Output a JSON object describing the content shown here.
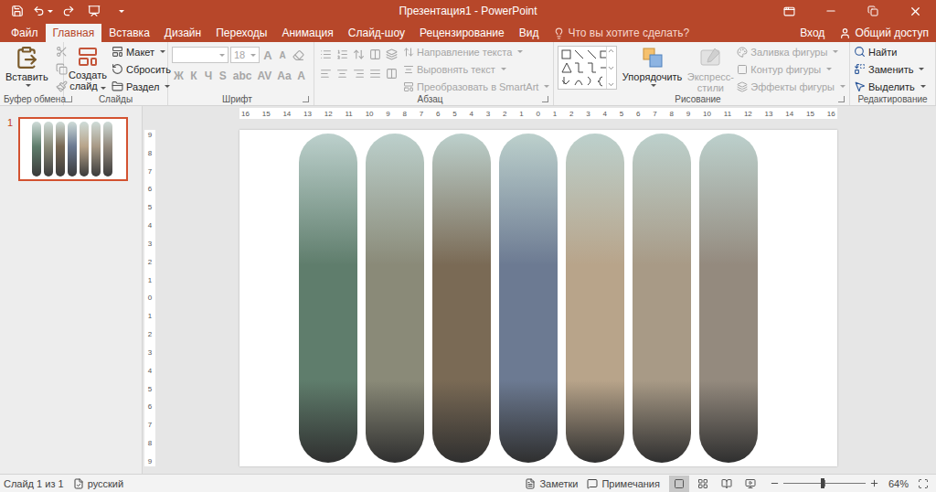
{
  "window": {
    "title": "Презентация1 - PowerPoint"
  },
  "tabs": [
    {
      "label": "Файл",
      "selected": false
    },
    {
      "label": "Главная",
      "selected": true
    },
    {
      "label": "Вставка",
      "selected": false
    },
    {
      "label": "Дизайн",
      "selected": false
    },
    {
      "label": "Переходы",
      "selected": false
    },
    {
      "label": "Анимация",
      "selected": false
    },
    {
      "label": "Слайд-шоу",
      "selected": false
    },
    {
      "label": "Рецензирование",
      "selected": false
    },
    {
      "label": "Вид",
      "selected": false
    }
  ],
  "search": {
    "placeholder": "Что вы хотите сделать?"
  },
  "account": {
    "sign_in": "Вход",
    "share": "Общий доступ"
  },
  "ribbon": {
    "clipboard": {
      "label": "Буфер обмена",
      "paste": "Вставить"
    },
    "slides": {
      "label": "Слайды",
      "new_slide": "Создать слайд",
      "items": [
        {
          "label": "Макет",
          "dropdown": true
        },
        {
          "label": "Сбросить",
          "dropdown": false
        },
        {
          "label": "Раздел",
          "dropdown": true
        }
      ]
    },
    "font": {
      "label": "Шрифт",
      "name": "",
      "size": "18",
      "disabled": true,
      "size_buttons": [
        "A",
        "A"
      ],
      "style_buttons": [
        "Ж",
        "К",
        "Ч",
        "S",
        "abc",
        "AV",
        "Aa",
        "A"
      ]
    },
    "paragraph": {
      "label": "Абзац",
      "disabled": true,
      "commands": [
        "Направление текста",
        "Выровнять текст",
        "Преобразовать в SmartArt"
      ]
    },
    "drawing": {
      "label": "Рисование",
      "arrange": "Упорядочить",
      "quick_styles": "Экспресс-стили",
      "quick_styles_disabled": true,
      "commands": [
        {
          "label": "Заливка фигуры",
          "disabled": true
        },
        {
          "label": "Контур фигуры",
          "disabled": true
        },
        {
          "label": "Эффекты фигуры",
          "disabled": true
        }
      ]
    },
    "editing": {
      "label": "Редактирование",
      "commands": [
        {
          "label": "Найти",
          "dropdown": false
        },
        {
          "label": "Заменить",
          "dropdown": true
        },
        {
          "label": "Выделить",
          "dropdown": true
        }
      ]
    }
  },
  "rulers": {
    "horizontal": [
      "16",
      "15",
      "14",
      "13",
      "12",
      "11",
      "10",
      "9",
      "8",
      "7",
      "6",
      "5",
      "4",
      "3",
      "2",
      "1",
      "0",
      "1",
      "2",
      "3",
      "4",
      "5",
      "6",
      "7",
      "8",
      "9",
      "10",
      "11",
      "12",
      "13",
      "14",
      "15",
      "16"
    ],
    "vertical": [
      "9",
      "8",
      "7",
      "6",
      "5",
      "4",
      "3",
      "2",
      "1",
      "0",
      "1",
      "2",
      "3",
      "4",
      "5",
      "6",
      "7",
      "8",
      "9"
    ]
  },
  "thumbnails": [
    {
      "number": "1",
      "selected": true
    }
  ],
  "slide": {
    "strips": [
      {
        "color": "#5f7d6c"
      },
      {
        "color": "#8a8a78"
      },
      {
        "color": "#7a6a55"
      },
      {
        "color": "#6c7a92"
      },
      {
        "color": "#b8a48a"
      },
      {
        "color": "#a89a86"
      },
      {
        "color": "#948a7e"
      }
    ]
  },
  "status_bar": {
    "slide": "Слайд 1 из 1",
    "language": "русский",
    "notes": "Заметки",
    "comments": "Примечания",
    "zoom": "64%",
    "zoom_level": 0.48,
    "views": [
      {
        "selected": true
      },
      {
        "selected": false
      },
      {
        "selected": false
      },
      {
        "selected": false
      }
    ]
  }
}
